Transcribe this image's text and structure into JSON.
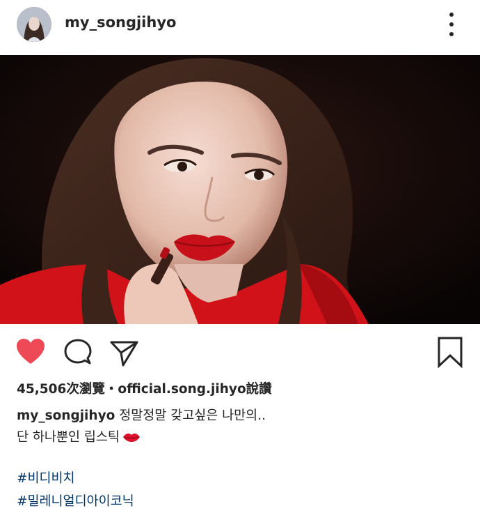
{
  "post": {
    "username": "my_songjihyo",
    "avatar_icon": "profile-avatar",
    "more_icon": "more-vertical-icon"
  },
  "actions": {
    "like_icon": "heart-filled-icon",
    "comment_icon": "comment-icon",
    "share_icon": "send-icon",
    "save_icon": "bookmark-icon",
    "like_color": "#ed4956"
  },
  "stats": {
    "views_liked": "45,506次瀏覽・official.song.jihyo說讚"
  },
  "caption": {
    "username": "my_songjihyo",
    "line1": " 정말정말 갖고싶은 나만의..",
    "line2": "단 하나뿐인 립스틱",
    "emoji": "lips-kiss-icon"
  },
  "hashtags": [
    "#비디비치",
    "#밀레니얼디아이코닉"
  ],
  "colors": {
    "hashtag": "#003569",
    "text": "#262626",
    "lipstick_red": "#c8101a"
  }
}
